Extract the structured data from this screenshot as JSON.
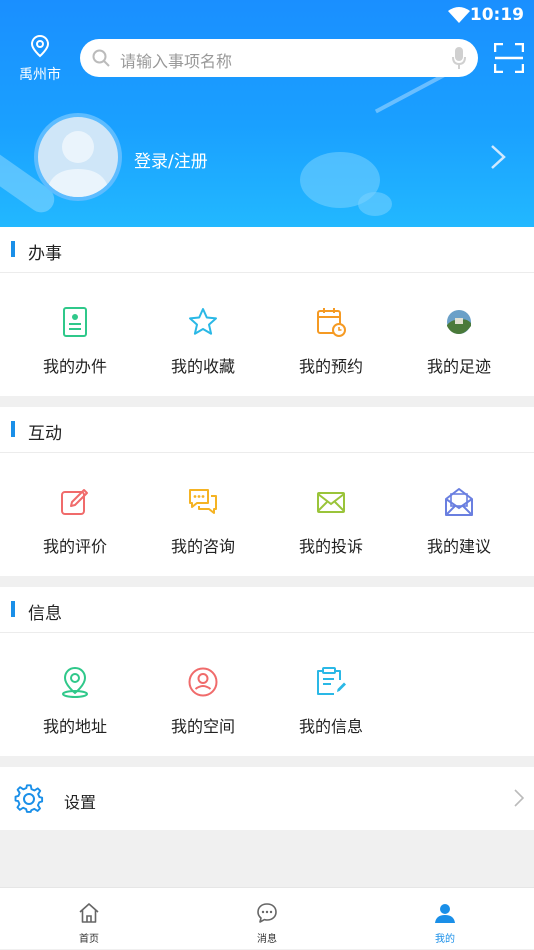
{
  "status_bar": {
    "time": "10:19"
  },
  "header": {
    "city": "禹州市",
    "search_placeholder": "请输入事项名称",
    "login_text": "登录/注册"
  },
  "sections": [
    {
      "title": "办事",
      "items": [
        {
          "label": "我的办件",
          "icon": "document-icon",
          "color": "#2fc88a"
        },
        {
          "label": "我的收藏",
          "icon": "star-icon",
          "color": "#2ab8e6"
        },
        {
          "label": "我的预约",
          "icon": "calendar-clock-icon",
          "color": "#f59a23"
        },
        {
          "label": "我的足迹",
          "icon": "footprint-photo-icon",
          "color": "#4a7a3a"
        }
      ]
    },
    {
      "title": "互动",
      "items": [
        {
          "label": "我的评价",
          "icon": "edit-icon",
          "color": "#f06b6b"
        },
        {
          "label": "我的咨询",
          "icon": "chat-icon",
          "color": "#f5b323"
        },
        {
          "label": "我的投诉",
          "icon": "envelope-icon",
          "color": "#9ac43a"
        },
        {
          "label": "我的建议",
          "icon": "open-envelope-icon",
          "color": "#6a7fe0"
        }
      ]
    },
    {
      "title": "信息",
      "items": [
        {
          "label": "我的地址",
          "icon": "location-pin-icon",
          "color": "#2fc88a"
        },
        {
          "label": "我的空间",
          "icon": "user-circle-icon",
          "color": "#f06b6b"
        },
        {
          "label": "我的信息",
          "icon": "note-edit-icon",
          "color": "#2ab8e6"
        }
      ]
    }
  ],
  "settings": {
    "label": "设置"
  },
  "tabs": [
    {
      "label": "首页",
      "icon": "home-icon"
    },
    {
      "label": "消息",
      "icon": "message-icon"
    },
    {
      "label": "我的",
      "icon": "profile-icon",
      "active": true
    }
  ],
  "colors": {
    "primary": "#1a8fe8",
    "header_top": "#1a8fff",
    "header_bottom": "#22b8ff"
  }
}
